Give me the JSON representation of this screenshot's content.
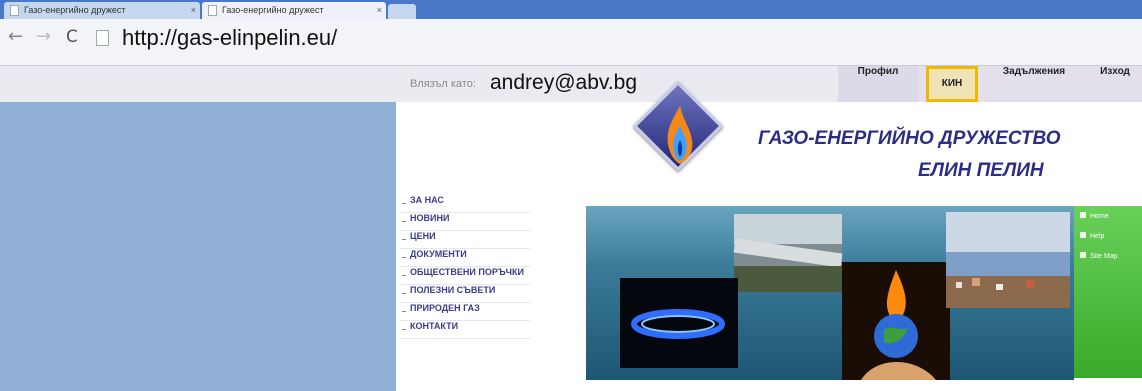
{
  "browser": {
    "tabs": [
      {
        "title": "Газо-енергийно дружест"
      },
      {
        "title": "Газо-енергийно дружест"
      }
    ],
    "close_glyph": "×",
    "nav": {
      "back": "←",
      "forward": "→",
      "reload": "C"
    },
    "url": "http://gas-elinpelin.eu/"
  },
  "userbar": {
    "logged_in_label": "Влязъл като:",
    "user_email": "andrey@abv.bg",
    "menu": {
      "profile": "Профил",
      "kin": "КИН",
      "debts": "Задължения",
      "logout": "Изход"
    }
  },
  "header": {
    "company_line1": "ГАЗО-ЕНЕРГИЙНО ДРУЖЕСТВО",
    "company_line2": "ЕЛИН ПЕЛИН"
  },
  "main_nav": {
    "items": [
      "ЗА НАС",
      "НОВИНИ",
      "ЦЕНИ",
      "ДОКУМЕНТИ",
      "ОБЩЕСТВЕНИ ПОРЪЧКИ",
      "ПОЛЕЗНИ СЪВЕТИ",
      "ПРИРОДЕН ГАЗ",
      "КОНТАКТИ"
    ]
  },
  "banner": {
    "side_links": [
      "Home",
      "Help",
      "Site Map"
    ]
  },
  "colors": {
    "tabstrip": "#4a78c8",
    "sidebar": "#8fb0d4",
    "brand_text": "#2b2e86",
    "kin_highlight": "#f1b800",
    "banner_green": "#3aa92b"
  },
  "icons": [
    "page-icon",
    "back-arrow-icon",
    "forward-arrow-icon",
    "reload-icon",
    "logo-flame-icon",
    "home-icon",
    "help-icon",
    "sitemap-icon"
  ]
}
